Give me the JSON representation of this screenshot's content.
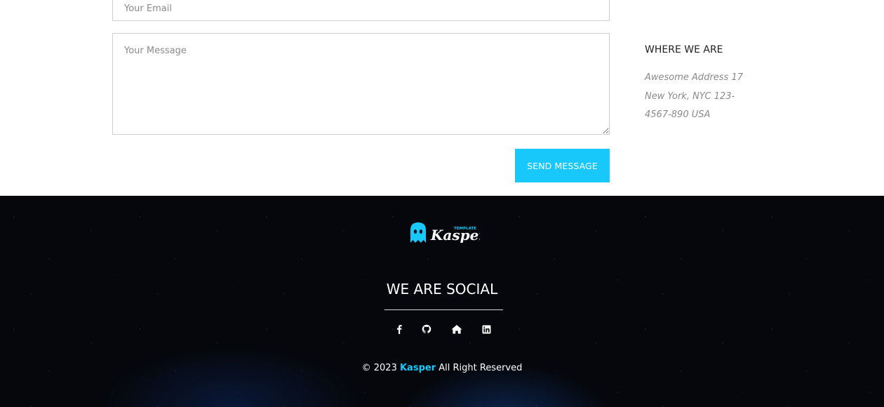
{
  "contact": {
    "email_placeholder": "Your Email",
    "message_placeholder": "Your Message",
    "send_label": "SEND MESSAGE",
    "location": {
      "title": "WHERE WE ARE",
      "address_lines": [
        "Awesome Address 17",
        "New York, NYC 123-",
        "4567-890 USA"
      ]
    }
  },
  "footer": {
    "logo": {
      "text": "Kasper",
      "tag": "TEMPLATE",
      "icon": "ghost-icon"
    },
    "social_title": "WE ARE SOCIAL",
    "social_icons": [
      "facebook-icon",
      "github-icon",
      "home-icon",
      "linkedin-icon"
    ],
    "copyright": {
      "prefix": "© 2023",
      "brand": "Kasper",
      "suffix": "All Right Reserved"
    }
  },
  "colors": {
    "accent": "#19c8fa",
    "footer_bg": "#05070c"
  }
}
